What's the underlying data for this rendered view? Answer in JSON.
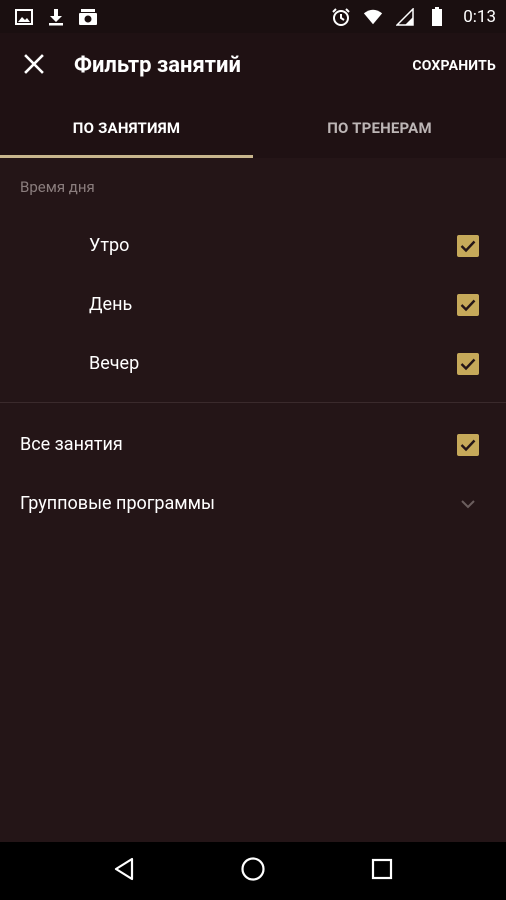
{
  "status_bar": {
    "time": "0:13",
    "left_icons": [
      "image-icon",
      "download-icon",
      "photo-album-icon"
    ],
    "right_icons": [
      "alarm-icon",
      "wifi-icon",
      "signal-icon",
      "battery-icon"
    ]
  },
  "toolbar": {
    "title": "Фильтр занятий",
    "save_label": "СОХРАНИТЬ",
    "close_icon": "close-icon"
  },
  "tabs": [
    {
      "label": "ПО ЗАНЯТИЯМ",
      "active": true
    },
    {
      "label": "ПО ТРЕНЕРАМ",
      "active": false
    }
  ],
  "time_of_day": {
    "header": "Время дня",
    "options": [
      {
        "label": "Утро",
        "checked": true
      },
      {
        "label": "День",
        "checked": true
      },
      {
        "label": "Вечер",
        "checked": true
      }
    ]
  },
  "all_classes": {
    "label": "Все занятия",
    "checked": true
  },
  "group_programs": {
    "label": "Групповые программы",
    "icon": "chevron-down-icon"
  },
  "colors": {
    "background": "#241517",
    "toolbar": "#1f1113",
    "accent": "#c8b68d",
    "checkbox": "#c6a95a",
    "section_header": "#8a7d7d"
  },
  "nav_bar": {
    "icons": [
      "back-icon",
      "home-icon",
      "recents-icon"
    ]
  }
}
